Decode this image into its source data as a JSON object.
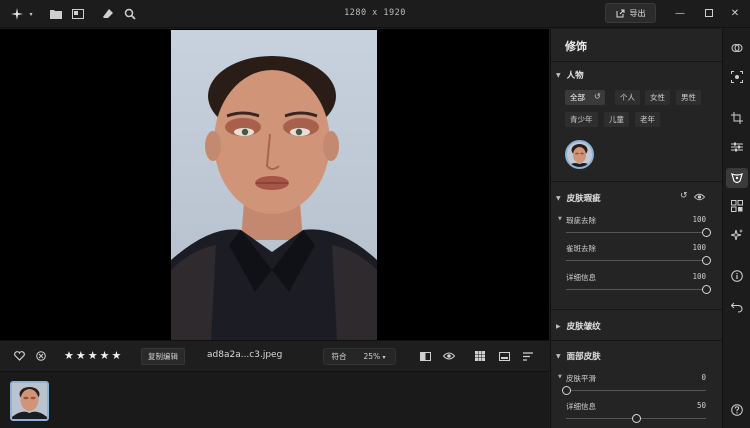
{
  "titlebar": {
    "dimensions": "1280 x 1920",
    "export_label": "导出",
    "icons": [
      "sparkle-icon",
      "folder-icon",
      "image-import-icon",
      "eraser-icon",
      "search-zoom-icon"
    ]
  },
  "toolbar": {
    "copy_edit_label": "复制编辑",
    "filename": "ad8a2a...c3.jpeg",
    "zoom_fit_label": "符合",
    "zoom_level": "25%",
    "rating": 5
  },
  "panel": {
    "title": "修饰",
    "people": {
      "label": "人物",
      "filters": [
        "全部",
        "个人",
        "女性",
        "男性",
        "青少年",
        "儿童",
        "老年"
      ],
      "active_filter": "全部"
    },
    "skin_blemish": {
      "label": "皮肤瑕疵",
      "sliders": [
        {
          "label": "瑕疵去除",
          "value": 100,
          "min": 0,
          "max": 100
        },
        {
          "label": "雀斑去除",
          "value": 100,
          "min": 0,
          "max": 100
        },
        {
          "label": "详细信息",
          "value": 100,
          "min": 0,
          "max": 100
        }
      ]
    },
    "skin_wrinkles": {
      "label": "皮肤皱纹"
    },
    "face_skin": {
      "label": "面部皮肤",
      "sliders": [
        {
          "label": "皮肤平滑",
          "value": 0,
          "min": 0,
          "max": 100
        },
        {
          "label": "详细信息",
          "value": 50,
          "min": 0,
          "max": 100
        }
      ]
    }
  },
  "colors": {
    "accent": "#8fb2d8",
    "background": "#1e1e1e",
    "panel": "#242424"
  }
}
